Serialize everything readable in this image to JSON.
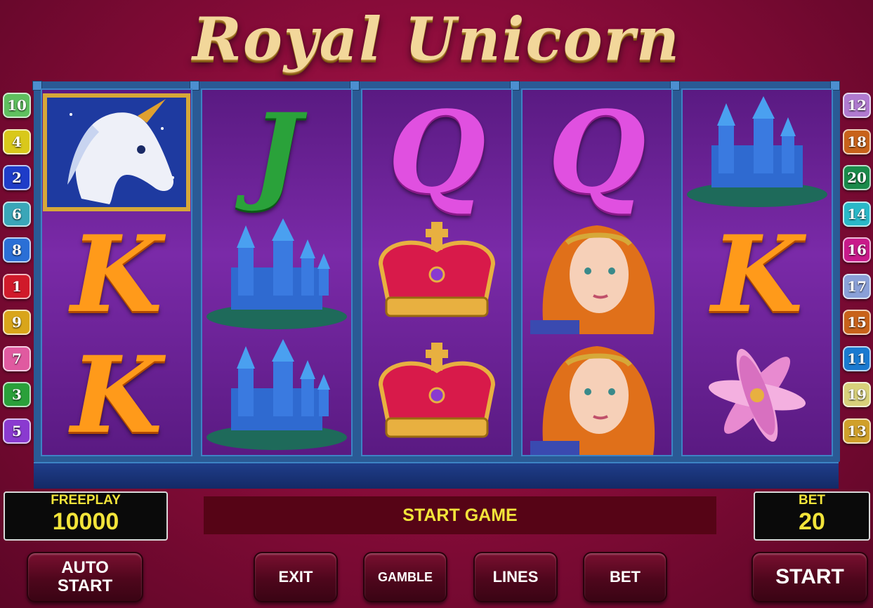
{
  "title": "Royal Unicorn",
  "paylines_left": [
    "10",
    "4",
    "2",
    "6",
    "8",
    "1",
    "9",
    "7",
    "3",
    "5"
  ],
  "paylines_right": [
    "12",
    "18",
    "20",
    "14",
    "16",
    "17",
    "15",
    "11",
    "19",
    "13"
  ],
  "payline_colors_left": [
    "#5fbf5f",
    "#d9c81a",
    "#1e3cc8",
    "#3aa6b8",
    "#2a6fd6",
    "#d01a2a",
    "#d9a51a",
    "#e05aa0",
    "#2aa03a",
    "#8a3ad0"
  ],
  "payline_colors_right": [
    "#b07ad0",
    "#c8621a",
    "#1a8a4a",
    "#2ab8c8",
    "#c81a8a",
    "#8aa0d8",
    "#c8621a",
    "#1a7ad0",
    "#d8d07a",
    "#d0a02a"
  ],
  "reels": [
    [
      "Unicorn",
      "K",
      "K"
    ],
    [
      "J",
      "Castle",
      "Castle"
    ],
    [
      "Q",
      "Crown",
      "Crown"
    ],
    [
      "Q",
      "Princess",
      "Princess"
    ],
    [
      "Castle",
      "K",
      "Lily"
    ]
  ],
  "freeplay": {
    "label": "FREEPLAY",
    "value": "10000"
  },
  "bet_panel": {
    "label": "BET",
    "value": "20"
  },
  "message": "START GAME",
  "buttons": {
    "auto_start_line1": "AUTO",
    "auto_start_line2": "START",
    "exit": "EXIT",
    "gamble": "GAMBLE",
    "lines": "LINES",
    "bet": "BET",
    "start": "START"
  },
  "colors": {
    "text_accent": "#f2e43a",
    "background": "#8a0c3a",
    "reel_frame": "#2a5a95"
  }
}
